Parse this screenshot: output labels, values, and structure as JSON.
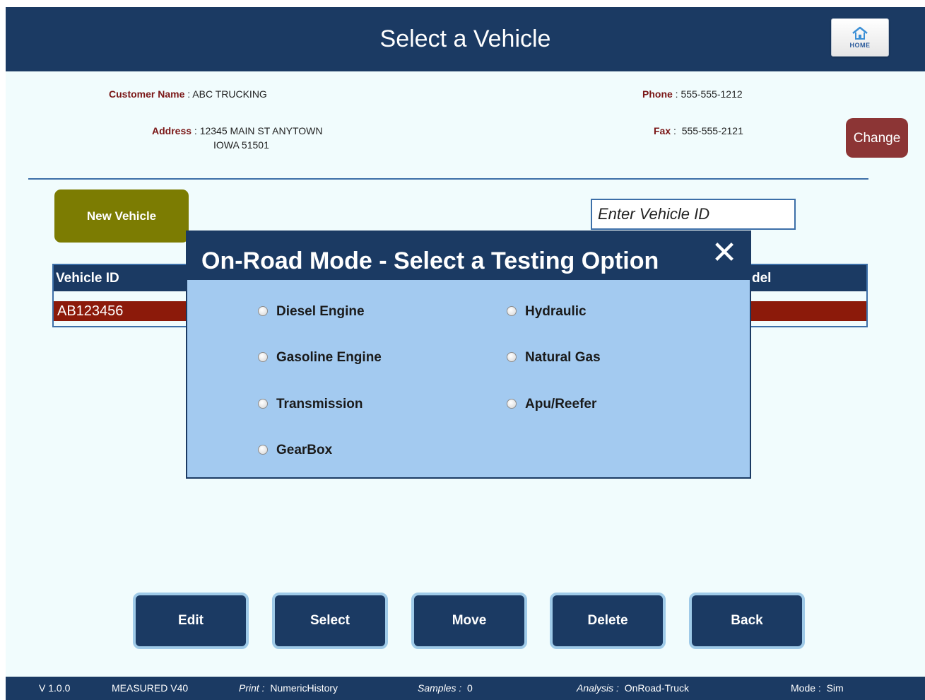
{
  "header": {
    "title": "Select a Vehicle",
    "home_label": "HOME"
  },
  "customer": {
    "name_label": "Customer Name",
    "name": "ABC TRUCKING",
    "address_label": "Address",
    "address_line1": "12345 MAIN ST ANYTOWN",
    "address_line2": "IOWA 51501",
    "phone_label": "Phone",
    "phone": "555-555-1212",
    "fax_label": "Fax",
    "fax": "555-555-2121",
    "change_label": "Change"
  },
  "toolbar": {
    "new_vehicle_label": "New Vehicle",
    "vehicle_id_placeholder": "Enter Vehicle ID"
  },
  "table": {
    "columns": [
      "Vehicle ID",
      "del"
    ],
    "rows": [
      {
        "vehicle_id": "AB123456"
      }
    ]
  },
  "modal": {
    "title": "On-Road Mode - Select a Testing Option",
    "close_glyph": "✕",
    "options": [
      "Diesel Engine",
      "Hydraulic",
      "Gasoline Engine",
      "Natural Gas",
      "Transmission",
      "Apu/Reefer",
      "GearBox"
    ]
  },
  "actions": {
    "edit": "Edit",
    "select": "Select",
    "move": "Move",
    "delete": "Delete",
    "back": "Back"
  },
  "footer": {
    "version": "V 1.0.0",
    "measured": "MEASURED V40",
    "print_label": "Print :",
    "print_value": "NumericHistory",
    "samples_label": "Samples :",
    "samples_value": "0",
    "analysis_label": "Analysis :",
    "analysis_value": "OnRoad-Truck",
    "mode_label": "Mode :",
    "mode_value": "Sim"
  },
  "colors": {
    "header_bg": "#1b3a63",
    "page_bg": "#f1fcfd",
    "modal_body_bg": "#a3caf0",
    "new_vehicle_bg": "#7c7c02",
    "change_bg": "#8c3535",
    "selected_row_bg": "#8c1a0a",
    "label_red": "#7a1616"
  }
}
